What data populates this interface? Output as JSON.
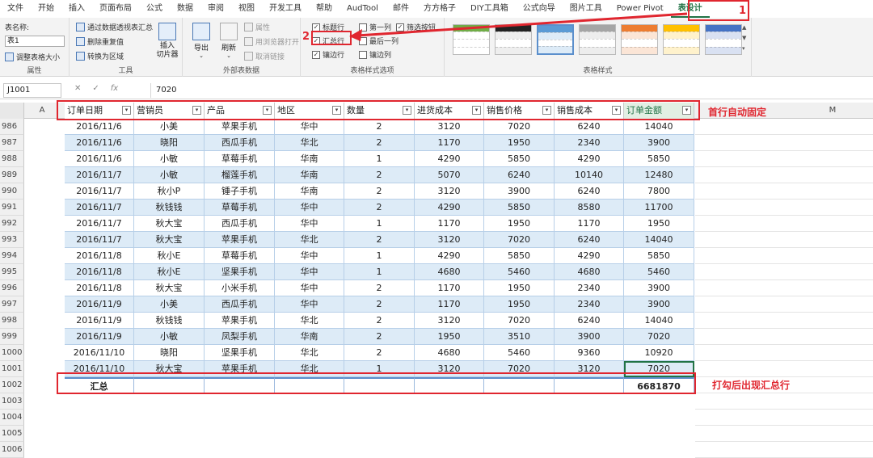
{
  "menu": {
    "tabs": [
      "文件",
      "开始",
      "插入",
      "页面布局",
      "公式",
      "数据",
      "审阅",
      "视图",
      "开发工具",
      "帮助",
      "AudTool",
      "邮件",
      "方方格子",
      "DIY工具箱",
      "公式向导",
      "图片工具",
      "Power Pivot",
      "表设计"
    ],
    "active_index": 17
  },
  "ribbon": {
    "properties": {
      "name_label": "表名称:",
      "name_value": "表1",
      "resize_label": "调整表格大小",
      "group_label": "属性"
    },
    "tools": {
      "pivot": "通过数据透视表汇总",
      "dedupe": "删除重复值",
      "convert": "转换为区域",
      "slicer": "插入\n切片器",
      "group_label": "工具"
    },
    "external": {
      "export": "导出",
      "refresh": "刷新",
      "properties": "属性",
      "open_browser": "用浏览器打开",
      "unlink": "取消链接",
      "group_label": "外部表数据"
    },
    "style_options": {
      "header_row": "标题行",
      "first_col": "第一列",
      "filter_btn": "筛选按钮",
      "total_row": "汇总行",
      "last_col": "最后一列",
      "banded_rows": "镶边行",
      "banded_cols": "镶边列",
      "group_label": "表格样式选项"
    },
    "styles": {
      "group_label": "表格样式"
    }
  },
  "annotations": {
    "num1": "1",
    "num2": "2",
    "freeze_note": "首行自动固定",
    "total_note": "打勾后出现汇总行"
  },
  "formula_bar": {
    "name_box": "J1001",
    "formula": "7020"
  },
  "columns": {
    "letters": [
      "A",
      "M"
    ],
    "headers": [
      "订单日期",
      "营销员",
      "产品",
      "地区",
      "数量",
      "进货成本",
      "销售价格",
      "销售成本",
      "订单金额"
    ]
  },
  "rows": [
    {
      "num": "986",
      "cells": [
        "2016/11/6",
        "小美",
        "苹果手机",
        "华中",
        "2",
        "3120",
        "7020",
        "6240",
        "14040"
      ]
    },
    {
      "num": "987",
      "cells": [
        "2016/11/6",
        "晓阳",
        "西瓜手机",
        "华北",
        "2",
        "1170",
        "1950",
        "2340",
        "3900"
      ]
    },
    {
      "num": "988",
      "cells": [
        "2016/11/6",
        "小敏",
        "草莓手机",
        "华南",
        "1",
        "4290",
        "5850",
        "4290",
        "5850"
      ]
    },
    {
      "num": "989",
      "cells": [
        "2016/11/7",
        "小敏",
        "榴莲手机",
        "华南",
        "2",
        "5070",
        "6240",
        "10140",
        "12480"
      ]
    },
    {
      "num": "990",
      "cells": [
        "2016/11/7",
        "秋小P",
        "锤子手机",
        "华南",
        "2",
        "3120",
        "3900",
        "6240",
        "7800"
      ]
    },
    {
      "num": "991",
      "cells": [
        "2016/11/7",
        "秋钱钱",
        "草莓手机",
        "华中",
        "2",
        "4290",
        "5850",
        "8580",
        "11700"
      ]
    },
    {
      "num": "992",
      "cells": [
        "2016/11/7",
        "秋大宝",
        "西瓜手机",
        "华中",
        "1",
        "1170",
        "1950",
        "1170",
        "1950"
      ]
    },
    {
      "num": "993",
      "cells": [
        "2016/11/7",
        "秋大宝",
        "苹果手机",
        "华北",
        "2",
        "3120",
        "7020",
        "6240",
        "14040"
      ]
    },
    {
      "num": "994",
      "cells": [
        "2016/11/8",
        "秋小E",
        "草莓手机",
        "华中",
        "1",
        "4290",
        "5850",
        "4290",
        "5850"
      ]
    },
    {
      "num": "995",
      "cells": [
        "2016/11/8",
        "秋小E",
        "坚果手机",
        "华中",
        "1",
        "4680",
        "5460",
        "4680",
        "5460"
      ]
    },
    {
      "num": "996",
      "cells": [
        "2016/11/8",
        "秋大宝",
        "小米手机",
        "华中",
        "2",
        "1170",
        "1950",
        "2340",
        "3900"
      ]
    },
    {
      "num": "997",
      "cells": [
        "2016/11/9",
        "小美",
        "西瓜手机",
        "华中",
        "2",
        "1170",
        "1950",
        "2340",
        "3900"
      ]
    },
    {
      "num": "998",
      "cells": [
        "2016/11/9",
        "秋钱钱",
        "苹果手机",
        "华北",
        "2",
        "3120",
        "7020",
        "6240",
        "14040"
      ]
    },
    {
      "num": "999",
      "cells": [
        "2016/11/9",
        "小敏",
        "凤梨手机",
        "华南",
        "2",
        "1950",
        "3510",
        "3900",
        "7020"
      ]
    },
    {
      "num": "1000",
      "cells": [
        "2016/11/10",
        "晓阳",
        "坚果手机",
        "华北",
        "2",
        "4680",
        "5460",
        "9360",
        "10920"
      ]
    },
    {
      "num": "1001",
      "cells": [
        "2016/11/10",
        "秋大宝",
        "苹果手机",
        "华北",
        "1",
        "3120",
        "7020",
        "3120",
        "7020"
      ]
    }
  ],
  "total_row": {
    "num": "1002",
    "label": "汇总",
    "value": "6681870"
  },
  "empty_rows": [
    "1003",
    "1004",
    "1005",
    "1006"
  ],
  "colors": {
    "accent": "#217346",
    "annotation": "#e0262f",
    "band": "#ddebf7"
  }
}
